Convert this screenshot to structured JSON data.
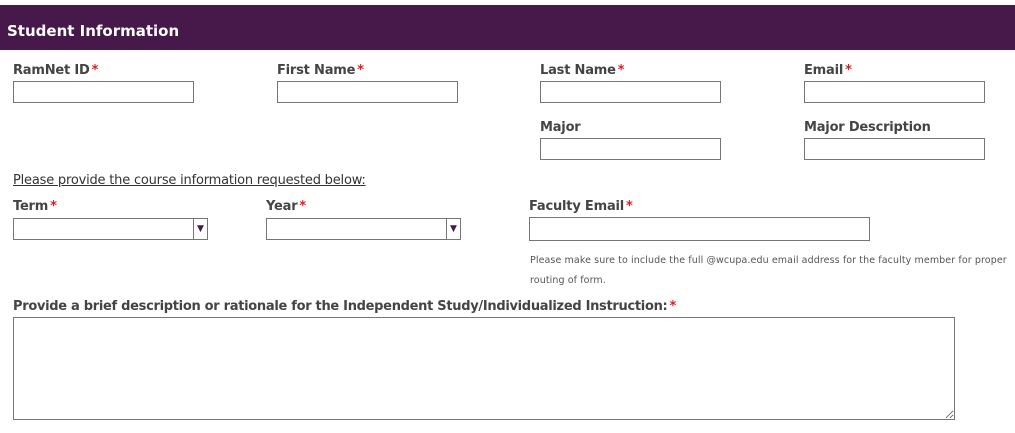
{
  "header": {
    "title": "Student Information"
  },
  "required_mark": "*",
  "fields": {
    "ramnet_id": {
      "label": "RamNet ID",
      "value": ""
    },
    "first_name": {
      "label": "First Name",
      "value": ""
    },
    "last_name": {
      "label": "Last Name",
      "value": ""
    },
    "email": {
      "label": "Email",
      "value": ""
    },
    "major": {
      "label": "Major",
      "value": ""
    },
    "major_description": {
      "label": "Major Description",
      "value": ""
    },
    "term": {
      "label": "Term",
      "selected": ""
    },
    "year": {
      "label": "Year",
      "selected": ""
    },
    "faculty_email": {
      "label": "Faculty Email",
      "value": ""
    },
    "description": {
      "label": "Provide a brief description or rationale for the Independent Study/Individualized Instruction:",
      "value": ""
    }
  },
  "course_section": {
    "instruction": "Please provide the course information requested below:"
  },
  "faculty_note": {
    "line1": "Please make sure to include the full @wcupa.edu email address for the faculty member for proper",
    "line2": "routing of form."
  },
  "icons": {
    "dropdown": "dropdown-arrow-icon",
    "resize": "resize-handle-icon"
  },
  "colors": {
    "header_bg": "#46194a",
    "required": "#e01b22",
    "arrow": "#46194a"
  }
}
